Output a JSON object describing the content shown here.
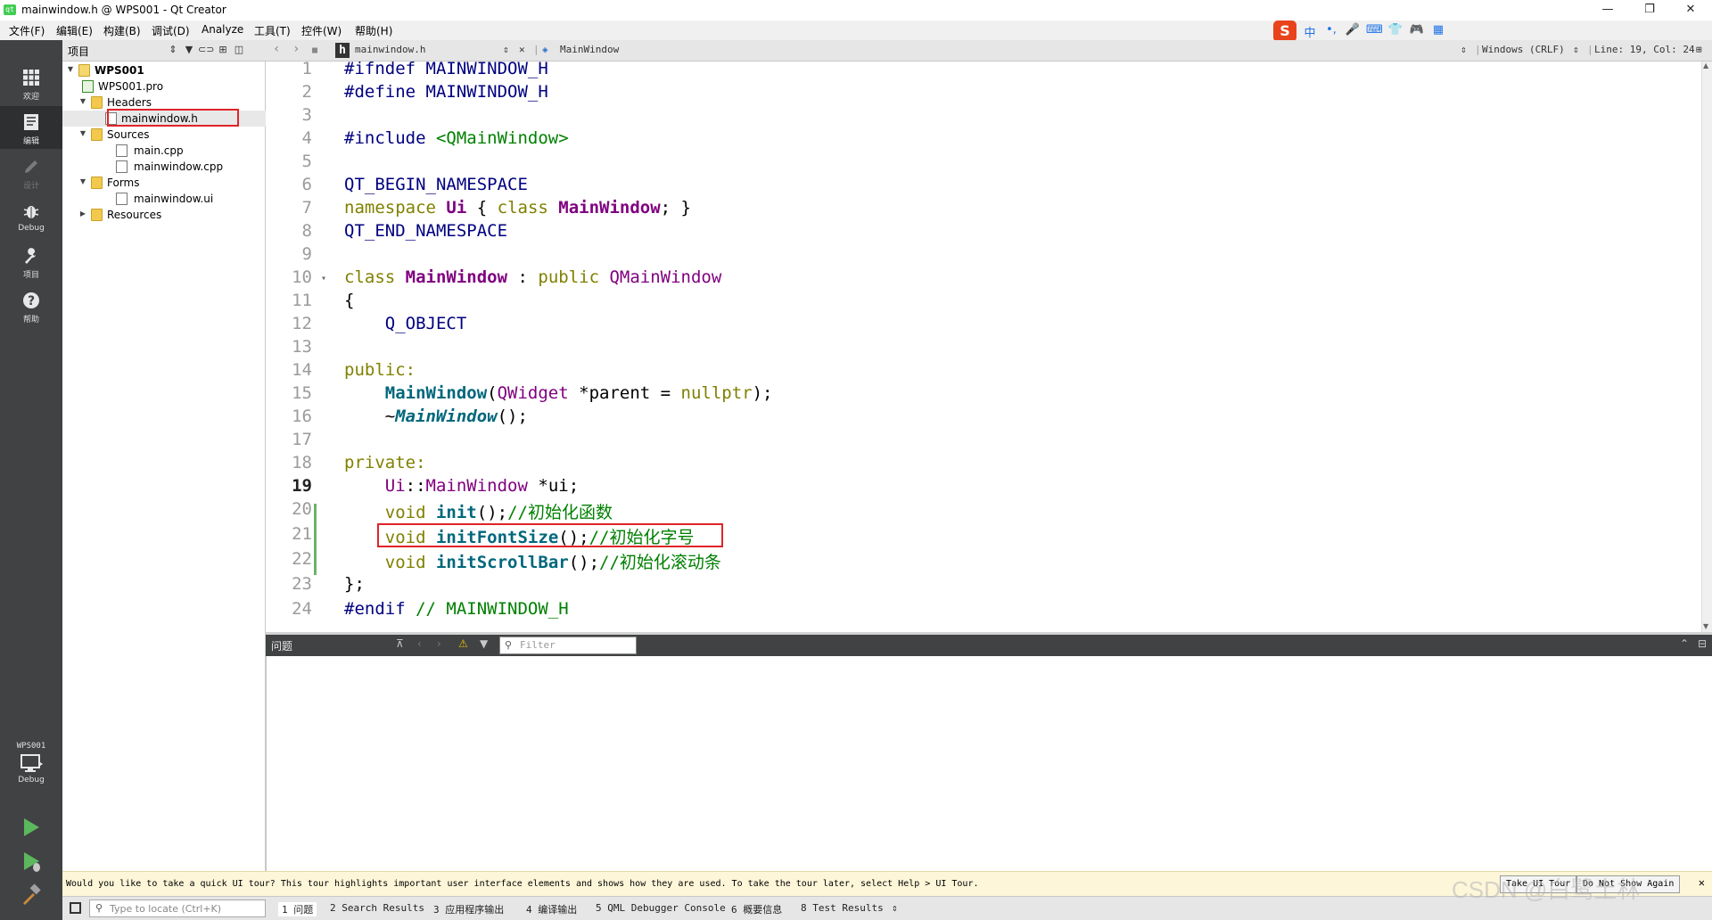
{
  "window": {
    "title": "mainwindow.h @ WPS001 - Qt Creator",
    "app_icon_text": "qt",
    "controls": {
      "minimize": "—",
      "maximize": "❐",
      "close": "✕"
    }
  },
  "menubar": {
    "items": [
      "文件(F)",
      "编辑(E)",
      "构建(B)",
      "调试(D)",
      "Analyze",
      "工具(T)",
      "控件(W)",
      "帮助(H)"
    ]
  },
  "ime_toolbar": {
    "logo": "S",
    "icons": [
      "中",
      "•,",
      "🎤",
      "⌨",
      "👕",
      "🎮",
      "▦"
    ]
  },
  "modebar": {
    "modes": [
      {
        "id": "welcome",
        "label": "欢迎",
        "icon": "grid-icon",
        "glyph": "▦",
        "active": false,
        "enabled": true
      },
      {
        "id": "edit",
        "label": "编辑",
        "icon": "edit-icon",
        "glyph": "▤",
        "active": true,
        "enabled": true
      },
      {
        "id": "design",
        "label": "设计",
        "icon": "pencil-icon",
        "glyph": "✎",
        "active": false,
        "enabled": false
      },
      {
        "id": "debug",
        "label": "Debug",
        "icon": "bug-icon",
        "glyph": "✸",
        "active": false,
        "enabled": true
      },
      {
        "id": "projects",
        "label": "项目",
        "icon": "wrench-icon",
        "glyph": "🔧",
        "active": false,
        "enabled": true
      },
      {
        "id": "help",
        "label": "帮助",
        "icon": "help-icon",
        "glyph": "?",
        "active": false,
        "enabled": true
      }
    ],
    "kit": {
      "project": "WPS001",
      "config": "Debug"
    }
  },
  "project_panel": {
    "header": "项目",
    "tree": [
      {
        "label": "WPS001",
        "type": "project",
        "level": 0,
        "expanded": true,
        "bold": true
      },
      {
        "label": "WPS001.pro",
        "type": "pro-file",
        "level": 1
      },
      {
        "label": "Headers",
        "type": "folder",
        "level": 1,
        "expanded": true
      },
      {
        "label": "mainwindow.h",
        "type": "header-file",
        "level": 2,
        "selected": true
      },
      {
        "label": "Sources",
        "type": "folder",
        "level": 1,
        "expanded": true
      },
      {
        "label": "main.cpp",
        "type": "source-file",
        "level": 2
      },
      {
        "label": "mainwindow.cpp",
        "type": "source-file",
        "level": 2
      },
      {
        "label": "Forms",
        "type": "folder",
        "level": 1,
        "expanded": true
      },
      {
        "label": "mainwindow.ui",
        "type": "ui-file",
        "level": 2
      },
      {
        "label": "Resources",
        "type": "folder",
        "level": 1,
        "expanded": false
      }
    ]
  },
  "editor_toolbar": {
    "file_name": "mainwindow.h",
    "file_icon": "h",
    "symbol": "MainWindow",
    "line_ending": "Windows (CRLF)",
    "position": "Line: 19, Col: 24"
  },
  "editor": {
    "current_line": 19,
    "line_numbers": [
      "1",
      "2",
      "3",
      "4",
      "5",
      "6",
      "7",
      "8",
      "9",
      "10",
      "11",
      "12",
      "13",
      "14",
      "15",
      "16",
      "17",
      "18",
      "19",
      "20",
      "21",
      "22",
      "23",
      "24"
    ],
    "code": {
      "l1_pp": "#ifndef",
      "l1_rest": " MAINWINDOW_H",
      "l2_pp": "#define",
      "l2_rest": " MAINWINDOW_H",
      "l4_pp": "#include",
      "l4_inc": " <QMainWindow>",
      "l6": "QT_BEGIN_NAMESPACE",
      "l7_kw": "namespace",
      "l7_ns": "Ui",
      "l7_mid": " { ",
      "l7_kw2": "class",
      "l7_cls": "MainWindow",
      "l7_end": "; }",
      "l8": "QT_END_NAMESPACE",
      "l10_kw": "class",
      "l10_cls": "MainWindow",
      "l10_mid": " : ",
      "l10_kw2": "public",
      "l10_base": "QMainWindow",
      "l11": "{",
      "l12": "Q_OBJECT",
      "l14": "public:",
      "l15_fn": "MainWindow",
      "l15_p1": "(",
      "l15_type": "QWidget",
      "l15_p2": " *parent = ",
      "l15_kw": "nullptr",
      "l15_end": ");",
      "l16_tilde": "~",
      "l16_fn": "MainWindow",
      "l16_end": "();",
      "l18": "private:",
      "l19_ns": "Ui",
      "l19_sep": "::",
      "l19_cls": "MainWindow",
      "l19_end": " *ui;",
      "l20_kw": "void",
      "l20_fn": "init",
      "l20_end": "();",
      "l20_cm": "//初始化函数",
      "l21_kw": "void",
      "l21_fn": "initFontSize",
      "l21_end": "();",
      "l21_cm": "//初始化字号",
      "l22_kw": "void",
      "l22_fn": "initScrollBar",
      "l22_end": "();",
      "l22_cm": "//初始化滚动条",
      "l23": "};",
      "l24_pp": "#endif",
      "l24_cm": " // MAINWINDOW_H"
    }
  },
  "issues": {
    "title": "问题",
    "filter_placeholder": "Filter"
  },
  "infobar": {
    "message": "Would you like to take a quick UI tour? This tour highlights important user interface elements and shows how they are used. To take the tour later, select Help > UI Tour.",
    "take_tour": "Take UI Tour",
    "do_not_show": "Do Not Show Again",
    "close": "✕"
  },
  "statusbar": {
    "locate_placeholder": "Type to locate (Ctrl+K)",
    "tabs": [
      "1 问题",
      "2 Search Results",
      "3 应用程序输出",
      "4 编译输出",
      "5 QML Debugger Console",
      "6 概要信息",
      "8 Test Results"
    ]
  },
  "watermark": "CSDN @白鹭土林"
}
